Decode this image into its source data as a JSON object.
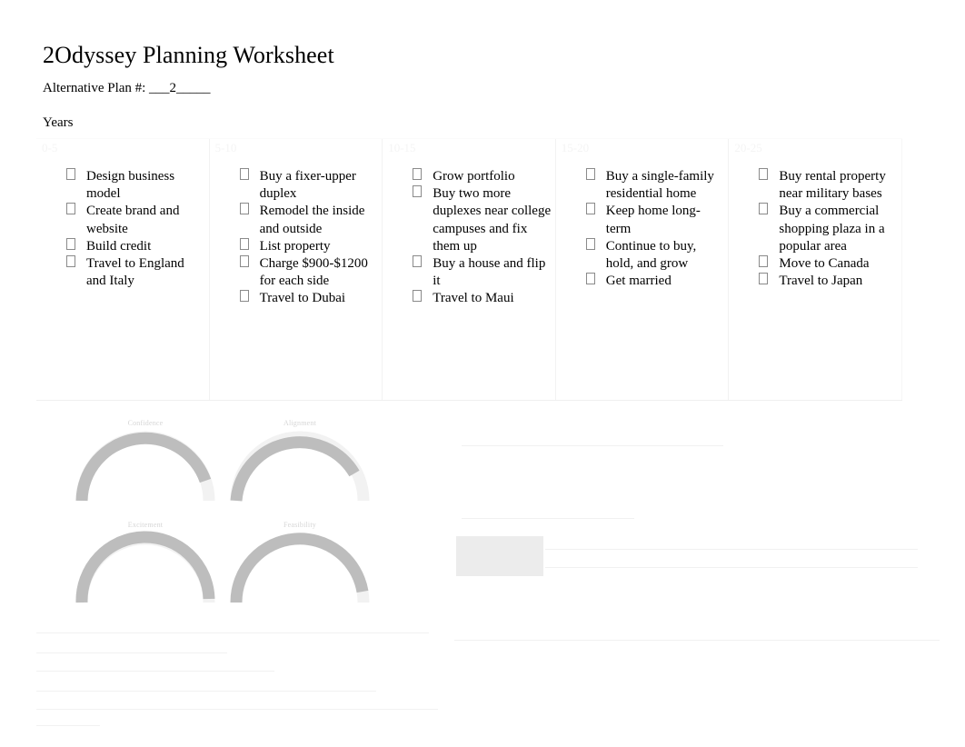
{
  "document": {
    "title": "2Odyssey Planning Worksheet",
    "alternative_plan_label": "Alternative Plan #:  ___2_____",
    "years_label": "Years"
  },
  "table": {
    "columns": [
      {
        "header": "0-5",
        "items": [
          "Design business model",
          "Create brand and website",
          "Build credit",
          "Travel to England and Italy"
        ]
      },
      {
        "header": "5-10",
        "items": [
          "Buy a fixer-upper duplex",
          "Remodel the inside and outside",
          "List property",
          "Charge $900-$1200 for each side",
          "Travel to Dubai"
        ]
      },
      {
        "header": "10-15",
        "items": [
          "Grow portfolio",
          "Buy two more duplexes near college campuses and fix them up",
          "Buy a house and flip it",
          "Travel to Maui"
        ]
      },
      {
        "header": "15-20",
        "items": [
          "Buy a single-family residential home",
          "Keep home long-term",
          "Continue to buy, hold, and grow",
          "Get married"
        ]
      },
      {
        "header": "20-25",
        "items": [
          "Buy rental property near military bases",
          "Buy a commercial shopping plaza in a popular area",
          "Move to Canada",
          "Travel to Japan"
        ]
      }
    ]
  },
  "chart_data": [
    {
      "type": "gauge",
      "title": "Confidence",
      "value": "",
      "min": "",
      "max": "",
      "percent": 72,
      "arc_color": "#b8b8b8",
      "track_color": "#f0f0f0"
    },
    {
      "type": "gauge",
      "title": "Alignment",
      "value": "",
      "min": "",
      "max": "",
      "percent": 68,
      "arc_color": "#b8b8b8",
      "track_color": "#f0f0f0"
    },
    {
      "type": "gauge",
      "title": "Excitement",
      "value": "",
      "min": "",
      "max": "",
      "percent": 80,
      "arc_color": "#b8b8b8",
      "track_color": "#f0f0f0"
    },
    {
      "type": "gauge",
      "title": "Feasibility",
      "value": "",
      "min": "",
      "max": "",
      "percent": 75,
      "arc_color": "#b8b8b8",
      "track_color": "#f0f0f0"
    }
  ],
  "notes": {
    "bottom_left": [
      "",
      "",
      "",
      "",
      "",
      ""
    ],
    "right": {
      "line1": "",
      "heading": "",
      "sub": ""
    }
  },
  "colors": {
    "page_background": "#ffffff",
    "text": "#000000",
    "table_border": "#f2f2f2",
    "faded_text": "#e6e6e6",
    "gauge_arc": "#b8b8b8"
  }
}
